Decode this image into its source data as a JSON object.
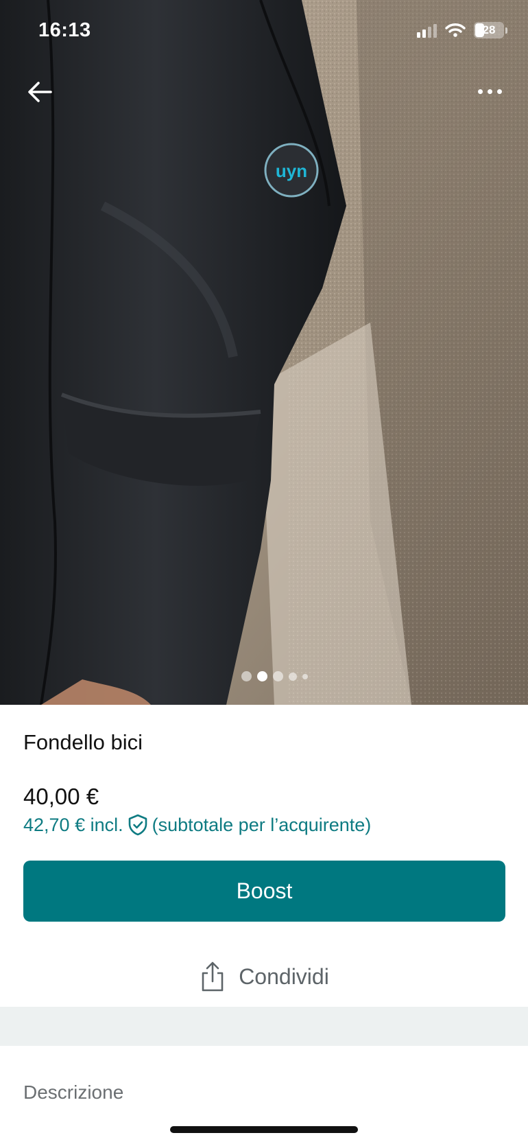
{
  "status_bar": {
    "time": "16:13",
    "battery": "28"
  },
  "product": {
    "title": "Fondello bici",
    "price": "40,00 €",
    "price_incl": "42,70 € incl.",
    "price_incl_note": "(subtotale per l’acquirente)"
  },
  "actions": {
    "boost_label": "Boost",
    "share_label": "Condividi"
  },
  "section": {
    "description_label": "Descrizione"
  },
  "carousel": {
    "image_count": 5,
    "active_index": 1
  },
  "icons": {
    "back": "arrow-left-icon",
    "more": "more-dots-icon",
    "shield": "shield-check-icon",
    "share": "share-icon"
  },
  "colors": {
    "accent": "#007880",
    "accent_text": "#0e7b82",
    "separator": "#edf1f1"
  }
}
